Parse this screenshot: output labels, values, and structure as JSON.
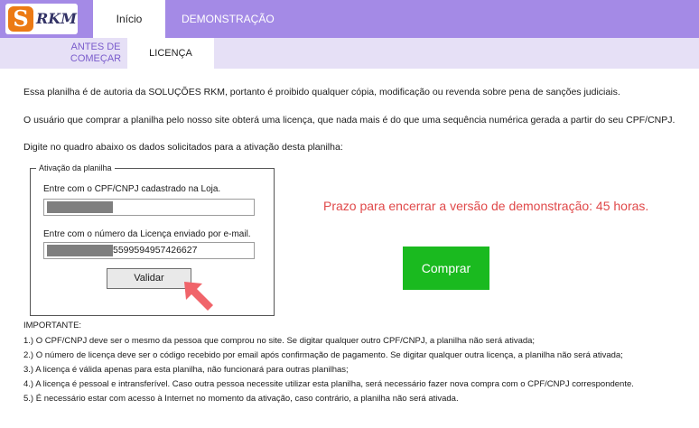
{
  "header": {
    "logo_letter": "S",
    "logo_text": "RKM",
    "tabs": [
      "Início",
      "DEMONSTRAÇÃO"
    ],
    "subtabs": [
      "ANTES DE COMEÇAR",
      "LICENÇA"
    ]
  },
  "paragraphs": [
    "Essa planilha é de autoria da SOLUÇÕES RKM, portanto é proibido qualquer cópia, modificação ou revenda sobre pena de sanções judiciais.",
    "O usuário que comprar a planilha pelo nosso site obterá uma licença, que nada mais é do que uma sequência numérica gerada a partir do seu CPF/CNPJ.",
    "Digite no quadro abaixo os dados solicitados para a ativação desta planilha:"
  ],
  "activation": {
    "legend": "Ativação da planilha",
    "cpf_label": "Entre com o CPF/CNPJ cadastrado na Loja.",
    "license_label": "Entre com o número da Licença enviado por e-mail.",
    "license_value_visible": "5599594957426627",
    "validate_label": "Validar"
  },
  "prazo_text": "Prazo para encerrar a versão de demonstração: 45 horas.",
  "comprar_label": "Comprar",
  "important": {
    "title": "IMPORTANTE:",
    "items": [
      "1.) O CPF/CNPJ deve ser o mesmo da pessoa que comprou no site. Se digitar qualquer outro CPF/CNPJ, a planilha não será ativada;",
      "2.) O número de licença deve ser o código recebido por email após confirmação de pagamento. Se digitar qualquer outra licença, a planilha não será ativada;",
      "3.) A licença é válida apenas para esta planilha, não funcionará para outras planilhas;",
      "4.) A licença é pessoal e intransferível. Caso outra pessoa necessite utilizar esta planilha, será necessário fazer nova compra com o CPF/CNPJ correspondente.",
      "5.) É necessário estar com acesso à Internet no momento da ativação, caso contrário, a planilha não será ativada."
    ]
  },
  "colors": {
    "topbar": "#a48ae6",
    "subbar": "#e6e0f6",
    "prazo": "#e0494a",
    "comprar": "#1aba1f",
    "arrow": "#f0646a"
  },
  "icons": [
    "logo-icon",
    "arrow-pointer-icon"
  ]
}
